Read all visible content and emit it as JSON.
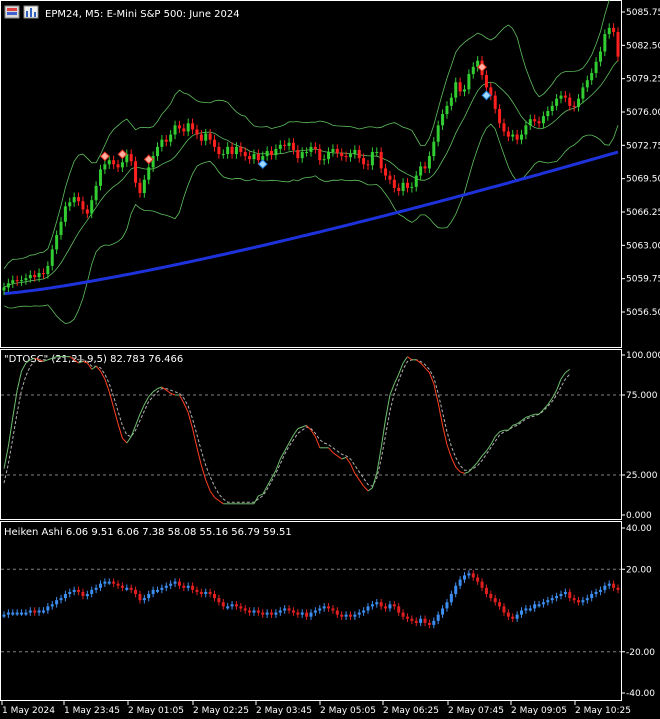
{
  "header": {
    "symbol_text": "EPM24, M5:  E-Mini S&P 500: June 2024",
    "icons": [
      "account-icon",
      "chart-icon"
    ]
  },
  "colors": {
    "background": "#000000",
    "bull": "#32cd32",
    "bear": "#ff2020",
    "ma_slow": "#1e32dc",
    "band": "#5fbf5f",
    "osc_fast_up": "#6fbf6f",
    "osc_fast_down": "#ff4020",
    "osc_slow": "#b0b0b0",
    "ha_up": "#3d8ef0",
    "ha_down": "#e02020",
    "grid_dash": "#808080"
  },
  "chart_data": [
    {
      "type": "candlestick",
      "name": "price",
      "title": "EPM24, M5:  E-Mini S&P 500: June 2024",
      "yticks": [
        "5085.75",
        "5082.50",
        "5079.25",
        "5076.00",
        "5072.75",
        "5069.50",
        "5066.25",
        "5063.00",
        "5059.75",
        "5056.50"
      ],
      "ylim": [
        5054.5,
        5087.0
      ],
      "close": [
        5058.9,
        5059.3,
        5059.6,
        5059.5,
        5059.6,
        5059.8,
        5060.1,
        5059.9,
        5060.3,
        5060.2,
        5061.0,
        5062.6,
        5064.0,
        5065.3,
        5066.8,
        5067.2,
        5067.7,
        5067.3,
        5066.5,
        5066.1,
        5067.4,
        5068.8,
        5070.4,
        5070.9,
        5071.3,
        5070.9,
        5070.6,
        5071.1,
        5071.9,
        5071.2,
        5069.1,
        5068.1,
        5069.4,
        5070.6,
        5071.7,
        5072.6,
        5073.3,
        5073.1,
        5073.8,
        5074.7,
        5074.4,
        5074.1,
        5074.9,
        5074.3,
        5073.8,
        5073.2,
        5073.9,
        5073.3,
        5072.6,
        5071.9,
        5071.9,
        5072.6,
        5071.9,
        5072.6,
        5072.1,
        5071.7,
        5071.4,
        5071.9,
        5071.3,
        5071.7,
        5072.2,
        5071.8,
        5072.4,
        5072.8,
        5072.7,
        5073.0,
        5072.3,
        5071.5,
        5072.1,
        5072.1,
        5072.6,
        5072.4,
        5071.3,
        5071.4,
        5072.1,
        5072.4,
        5072.0,
        5071.7,
        5071.6,
        5071.9,
        5072.3,
        5071.5,
        5070.9,
        5070.8,
        5072.1,
        5072.1,
        5070.5,
        5069.8,
        5069.4,
        5068.6,
        5068.3,
        5069.1,
        5068.6,
        5068.7,
        5069.8,
        5070.7,
        5070.5,
        5071.7,
        5073.1,
        5074.7,
        5075.8,
        5076.6,
        5077.4,
        5078.9,
        5078.0,
        5078.2,
        5079.7,
        5080.4,
        5081.0,
        5079.6,
        5078.4,
        5077.6,
        5076.3,
        5074.9,
        5074.1,
        5073.6,
        5073.8,
        5073.3,
        5073.8,
        5074.7,
        5075.3,
        5075.1,
        5074.9,
        5075.6,
        5076.1,
        5076.6,
        5077.3,
        5077.6,
        5077.4,
        5076.6,
        5076.5,
        5077.3,
        5078.4,
        5079.1,
        5079.8,
        5080.9,
        5081.9,
        5083.6,
        5084.2,
        5083.8,
        5081.4
      ]
    },
    {
      "type": "line",
      "name": "DTOSC",
      "label": "\"DTOSC\" (21,21,9,5) 82.783 76.466",
      "yticks": [
        "100.000",
        "75.000",
        "25.000",
        "0.000"
      ],
      "levels": [
        75,
        25
      ],
      "ylim": [
        0,
        100
      ],
      "fast": [
        29,
        43,
        61,
        78,
        90,
        95,
        97,
        98,
        97,
        96,
        97,
        98,
        99,
        99,
        99,
        99,
        97,
        95,
        96,
        95,
        91,
        93,
        90,
        85,
        77,
        67,
        57,
        48,
        45,
        49,
        56,
        63,
        69,
        74,
        77,
        79,
        80,
        78,
        76,
        75,
        75,
        70,
        64,
        54,
        42,
        31,
        22,
        15,
        11,
        9,
        7,
        7,
        7,
        7,
        7,
        7,
        7,
        7,
        12,
        13,
        18,
        23,
        28,
        35,
        40,
        45,
        50,
        54,
        55,
        56,
        53,
        49,
        42,
        42,
        42,
        39,
        37,
        35,
        36,
        32,
        26,
        22,
        18,
        15,
        17,
        26,
        42,
        60,
        75,
        82,
        88,
        95,
        99,
        97,
        97,
        95,
        92,
        89,
        82,
        70,
        56,
        44,
        36,
        30,
        27,
        26,
        27,
        30,
        33,
        37,
        40,
        44,
        49,
        52,
        53,
        53,
        56,
        57,
        59,
        61,
        62,
        63,
        63,
        66,
        69,
        73,
        78,
        85,
        89,
        91
      ],
      "slow": [
        20,
        32,
        48,
        64,
        78,
        87,
        93,
        96,
        97,
        97,
        97,
        98,
        98,
        98,
        99,
        99,
        98,
        97,
        97,
        96,
        93,
        93,
        92,
        88,
        82,
        74,
        65,
        56,
        50,
        49,
        53,
        59,
        65,
        71,
        74,
        77,
        79,
        79,
        78,
        77,
        76,
        73,
        68,
        60,
        50,
        40,
        31,
        24,
        18,
        13,
        10,
        8,
        8,
        8,
        8,
        8,
        8,
        8,
        10,
        12,
        16,
        21,
        26,
        32,
        38,
        43,
        47,
        51,
        53,
        55,
        54,
        51,
        47,
        45,
        44,
        42,
        40,
        38,
        37,
        35,
        31,
        27,
        23,
        19,
        18,
        23,
        35,
        50,
        65,
        76,
        84,
        91,
        96,
        97,
        97,
        96,
        94,
        91,
        86,
        76,
        64,
        52,
        43,
        36,
        31,
        28,
        28,
        29,
        31,
        34,
        38,
        42,
        46,
        50,
        52,
        53,
        55,
        56,
        58,
        60,
        61,
        62,
        63,
        65,
        68,
        71,
        75,
        80,
        85,
        88
      ]
    },
    {
      "type": "bar",
      "name": "Heiken Ashi",
      "label": "Heiken Ashi 6.06 9.51 6.06 7.38 58.08 55.16 56.79 59.51",
      "yticks": [
        "40.00",
        "20.00",
        "-20.00",
        "-40.00"
      ],
      "levels": [
        20,
        -20
      ],
      "ylim": [
        -40,
        40
      ],
      "values": [
        -2,
        -1,
        -1,
        -1,
        -1,
        -1,
        0,
        -1,
        0,
        0,
        2,
        3,
        5,
        6,
        8,
        9,
        10,
        9,
        7,
        8,
        10,
        11,
        13,
        14,
        14,
        13,
        12,
        11,
        11,
        10,
        8,
        5,
        6,
        8,
        10,
        10,
        11,
        12,
        13,
        14,
        12,
        11,
        12,
        10,
        9,
        8,
        9,
        8,
        6,
        4,
        2,
        2,
        3,
        2,
        1,
        0,
        -1,
        0,
        -1,
        -2,
        -1,
        -2,
        -1,
        0,
        1,
        0,
        -1,
        -2,
        -1,
        -3,
        -1,
        0,
        1,
        2,
        1,
        0,
        -2,
        -3,
        -2,
        -3,
        -2,
        -1,
        0,
        2,
        3,
        4,
        2,
        1,
        3,
        2,
        -1,
        -3,
        -4,
        -5,
        -6,
        -4,
        -6,
        -7,
        -5,
        -2,
        1,
        4,
        8,
        12,
        15,
        17,
        18,
        16,
        14,
        11,
        8,
        6,
        4,
        2,
        -1,
        -3,
        -4,
        -2,
        0,
        1,
        1,
        3,
        3,
        4,
        5,
        6,
        7,
        8,
        9,
        6,
        5,
        4,
        5,
        6,
        8,
        9,
        10,
        12,
        13,
        11,
        10
      ]
    }
  ],
  "x_axis": {
    "labels": [
      "1 May 2024",
      "1 May 23:45",
      "2 May 01:05",
      "2 May 02:25",
      "2 May 03:45",
      "2 May 05:05",
      "2 May 06:25",
      "2 May 07:45",
      "2 May 09:05",
      "2 May 10:25"
    ]
  }
}
